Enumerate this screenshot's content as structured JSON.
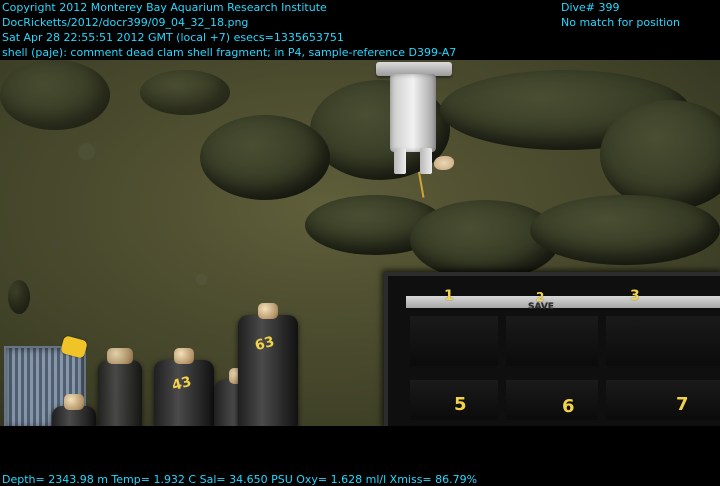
{
  "overlay": {
    "top_left_lines": [
      "Copyright 2012 Monterey Bay Aquarium Research Institute",
      "DocRicketts/2012/docr399/09_04_32_18.png",
      "Sat Apr 28 22:55:51 2012 GMT (local +7)  esecs=1335653751",
      "shell (paje): comment dead clam shell fragment; in P4, sample-reference D399-A7"
    ],
    "top_right_lines": [
      "Dive# 399",
      "No match for position"
    ],
    "bottom_line": "Depth= 2343.98 m  Temp= 1.932 C  Sal= 34.650 PSU  Oxy= 1.628 ml/l  Xmiss= 86.79%"
  },
  "sample_box": {
    "numbers": [
      "1",
      "2",
      "3",
      "5",
      "6",
      "7"
    ],
    "strip_text": "SAVE"
  },
  "sampler_tubes": {
    "labels": [
      "63",
      "43"
    ]
  },
  "colors": {
    "overlay_text": "#23d9ff",
    "box_numbers": "#f1d24a"
  }
}
